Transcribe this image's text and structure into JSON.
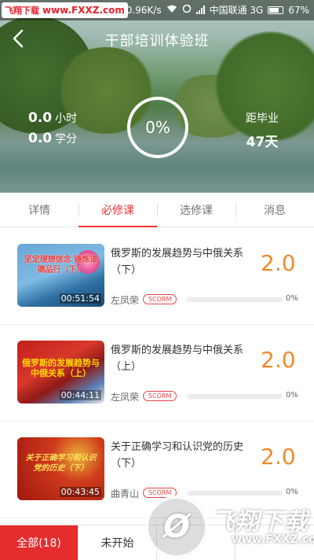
{
  "status_bar": {
    "watermark_brand": "飞翔下载",
    "watermark_url": "www.FXXZ.com",
    "speed": "0.96K/s",
    "carrier": "中国联通 3G",
    "battery": "67%"
  },
  "header": {
    "title": "干部培训体验班",
    "back_icon": "chevron-left-icon",
    "hours_value": "0.0",
    "hours_unit": "小时",
    "credits_value": "0.0",
    "credits_unit": "学分",
    "progress_text": "0%",
    "graduation_label": "距毕业",
    "graduation_days": "47天"
  },
  "tabs": [
    {
      "label": "详情",
      "active": false
    },
    {
      "label": "必修课",
      "active": true
    },
    {
      "label": "选修课",
      "active": false
    },
    {
      "label": "消息",
      "active": false
    }
  ],
  "courses": [
    {
      "title": "俄罗斯的发展趋势与中俄关系（下）",
      "thumb_caption": "坚定理想信念 锤炼道德品行（下）",
      "duration": "00:51:54",
      "teacher": "左凤荣",
      "tag": "SCORM",
      "credit": "2.0",
      "progress": "0%",
      "progress_value": 0
    },
    {
      "title": "俄罗斯的发展趋势与中俄关系（上）",
      "thumb_caption": "俄罗斯的发展趋势与中俄关系（上）",
      "duration": "00:44:11",
      "teacher": "左凤荣",
      "tag": "SCORM",
      "credit": "2.0",
      "progress": "0%",
      "progress_value": 0
    },
    {
      "title": "关于正确学习和认识党的历史（下）",
      "thumb_caption": "关于正确学习和认识党的历史（下）",
      "duration": "00:43:45",
      "teacher": "曲青山",
      "tag": "SCORM",
      "credit": "2.0",
      "progress": "0%",
      "progress_value": 0
    }
  ],
  "bottom_filters": [
    {
      "label": "全部(18)",
      "active": true
    },
    {
      "label": "未开始",
      "active": false
    },
    {
      "label": "",
      "active": false
    },
    {
      "label": "",
      "active": false
    }
  ],
  "watermark": {
    "logo_char": "Ø",
    "text": "飞翔下载",
    "url": "www.FXXZ.com"
  },
  "colors": {
    "accent": "#e33333",
    "credit": "#f08a2c",
    "bottom_active": "#e52d2d"
  }
}
